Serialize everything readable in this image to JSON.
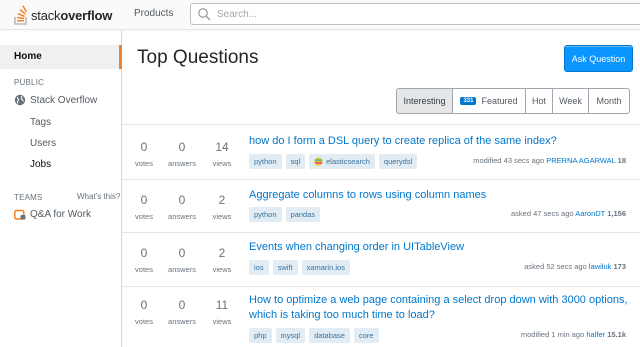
{
  "header": {
    "logo_text_light": "stack",
    "logo_text_bold": "overflow",
    "products_label": "Products",
    "search": {
      "placeholder": "Search..."
    }
  },
  "sidebar": {
    "home_label": "Home",
    "public_label": "PUBLIC",
    "stackoverflow_label": "Stack Overflow",
    "tags_label": "Tags",
    "users_label": "Users",
    "jobs_label": "Jobs",
    "teams_label": "TEAMS",
    "whats_this_label": "What's this?",
    "qa_work_label": "Q&A for Work"
  },
  "main": {
    "title": "Top Questions",
    "ask_button_label": "Ask Question",
    "filters": {
      "interesting": "Interesting",
      "featured_badge": "331",
      "featured": "Featured",
      "hot": "Hot",
      "week": "Week",
      "month": "Month"
    },
    "stat_labels": {
      "votes": "votes",
      "answers": "answers",
      "views": "views"
    },
    "questions": [
      {
        "votes": "0",
        "answers": "0",
        "views": "14",
        "title": "how do I form a DSL query to create replica of the same index?",
        "tags": [
          "python",
          "sql",
          "elasticsearch",
          "querydsl"
        ],
        "action": "modified 43 secs ago",
        "user": "PRERNA AGARWAL",
        "rep": "18"
      },
      {
        "votes": "0",
        "answers": "0",
        "views": "2",
        "title": "Aggregate columns to rows using column names",
        "tags": [
          "python",
          "pandas"
        ],
        "action": "asked 47 secs ago",
        "user": "AaronDT",
        "rep": "1,156"
      },
      {
        "votes": "0",
        "answers": "0",
        "views": "2",
        "title": "Events when changing order in UITableView",
        "tags": [
          "ios",
          "swift",
          "xamarin.ios"
        ],
        "action": "asked 52 secs ago",
        "user": "lawiluk",
        "rep": "173"
      },
      {
        "votes": "0",
        "answers": "0",
        "views": "11",
        "title_line1": "How to optimize a web page containing a select drop down with 3000 options,",
        "title_line2": "which is taking too much time to load?",
        "tags": [
          "php",
          "mysql",
          "database",
          "core"
        ],
        "action": "modified 1 min ago",
        "user": "halfer",
        "rep": "15.1k"
      }
    ]
  },
  "colors": {
    "brand_orange": "#f48024",
    "link_blue": "#0077cc",
    "button_blue": "#0a95ff",
    "tag_bg": "#e1ecf4",
    "tag_text": "#39739d"
  }
}
